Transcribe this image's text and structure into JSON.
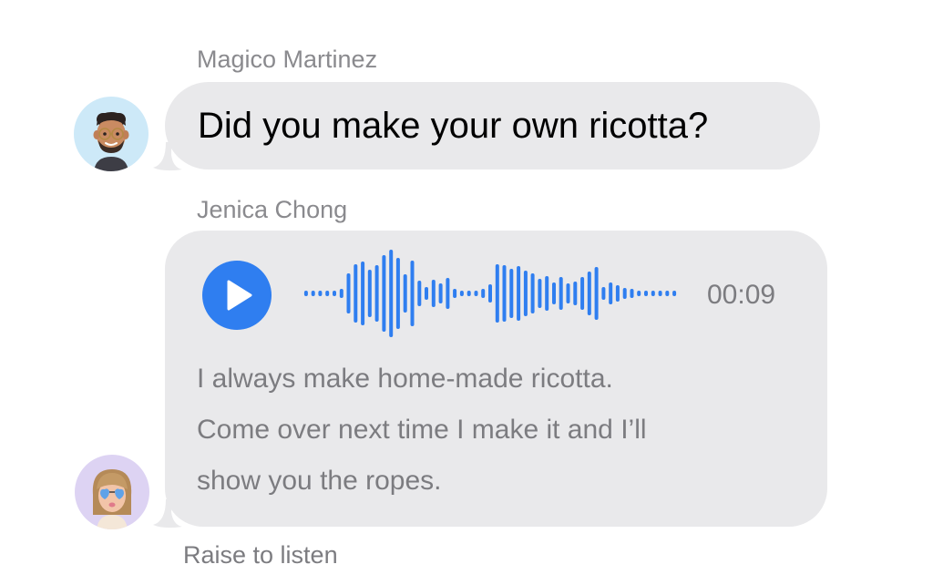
{
  "messages": [
    {
      "sender": "Magico Martinez",
      "text": "Did you make your own ricotta?",
      "avatar": "memoji-man-glasses",
      "avatar_bg": "#cde9f8"
    },
    {
      "sender": "Jenica Chong",
      "avatar": "memoji-woman-heart-glasses",
      "avatar_bg": "#ddd3f3",
      "audio": {
        "duration": "00:09",
        "play_icon": "play-icon",
        "accent": "#2f7ef0"
      },
      "transcript_lines": [
        "I always make home-made ricotta.",
        "Come over next time I make it and I’ll",
        "show you the ropes."
      ]
    }
  ],
  "footer": {
    "raise_to_listen": "Raise to listen"
  },
  "colors": {
    "bubble": "#e9e9eb",
    "secondary_text": "#8a8a8e",
    "accent": "#2f7ef0"
  }
}
